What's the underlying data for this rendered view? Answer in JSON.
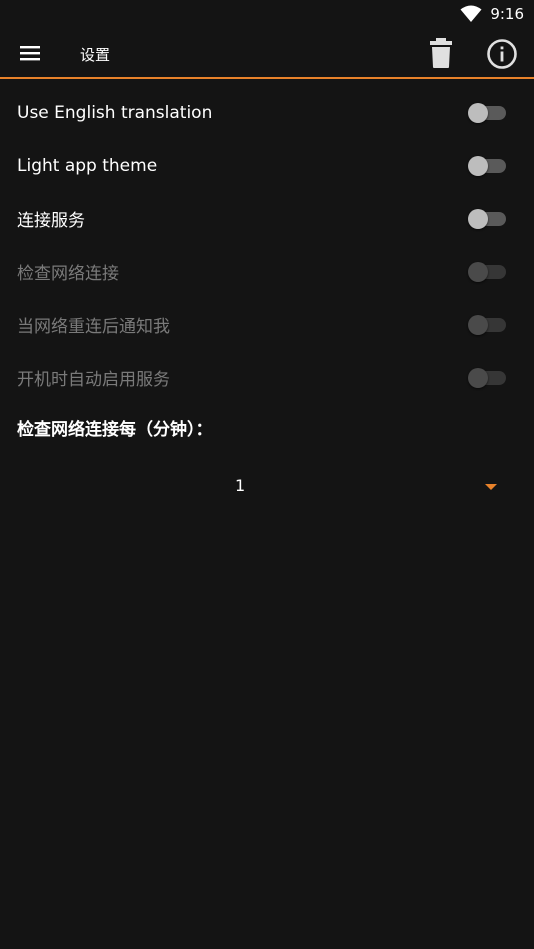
{
  "status_bar": {
    "time": "9:16",
    "wifi_icon": "wifi-icon"
  },
  "app_bar": {
    "title": "设置",
    "accent_color": "#e8822a",
    "icons": [
      "menu-icon",
      "delete-icon",
      "info-icon"
    ]
  },
  "settings": [
    {
      "label": "Use English translation",
      "enabled": true,
      "on": false
    },
    {
      "label": "Light app theme",
      "enabled": true,
      "on": false
    },
    {
      "label": "连接服务",
      "enabled": true,
      "on": false
    },
    {
      "label": "检查网络连接",
      "enabled": false,
      "on": false
    },
    {
      "label": "当网络重连后通知我",
      "enabled": false,
      "on": false
    },
    {
      "label": "开机时自动启用服务",
      "enabled": false,
      "on": false
    }
  ],
  "interval": {
    "label": "检查网络连接每（分钟）：",
    "selected": "1"
  }
}
